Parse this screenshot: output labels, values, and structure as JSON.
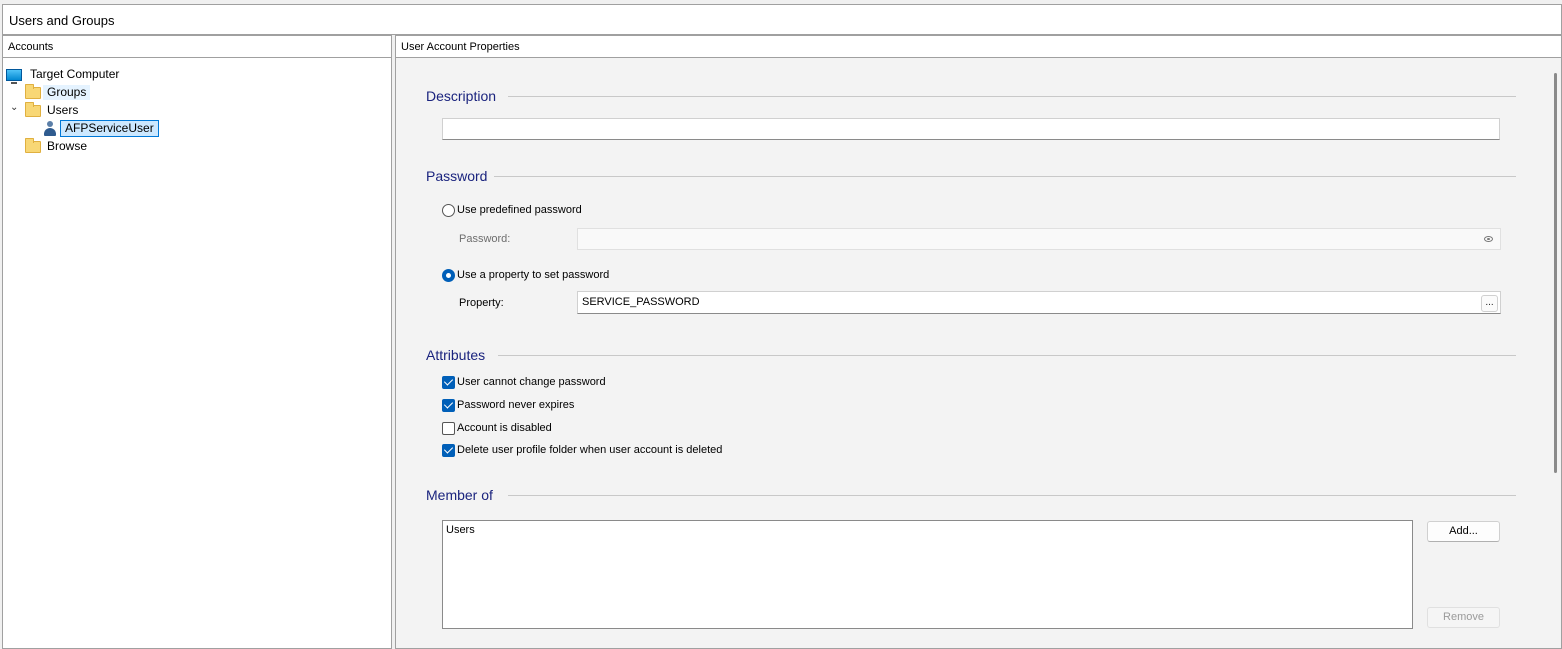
{
  "window": {
    "title": "Users and Groups"
  },
  "accounts": {
    "header": "Accounts",
    "tree": {
      "root": "Target Computer",
      "groups": "Groups",
      "users": "Users",
      "selected_user": "AFPServiceUser",
      "browse": "Browse"
    }
  },
  "properties": {
    "header": "User Account Properties",
    "description": {
      "title": "Description",
      "value": ""
    },
    "password": {
      "title": "Password",
      "predefined_label": "Use predefined password",
      "predefined_checked": false,
      "password_field_label": "Password:",
      "password_value": "",
      "property_option_label": "Use a property to set password",
      "property_checked": true,
      "property_field_label": "Property:",
      "property_value": "SERVICE_PASSWORD",
      "browse_button": "..."
    },
    "attributes": {
      "title": "Attributes",
      "items": [
        {
          "label": "User cannot change password",
          "checked": true
        },
        {
          "label": "Password never expires",
          "checked": true
        },
        {
          "label": "Account is disabled",
          "checked": false
        },
        {
          "label": "Delete user profile folder when user account is deleted",
          "checked": true
        }
      ]
    },
    "member_of": {
      "title": "Member of",
      "groups": [
        "Users"
      ],
      "add_button": "Add...",
      "remove_button": "Remove"
    }
  },
  "colors": {
    "section_title": "#1a237e",
    "accent": "#005fb8",
    "selection": "#cce8ff"
  }
}
